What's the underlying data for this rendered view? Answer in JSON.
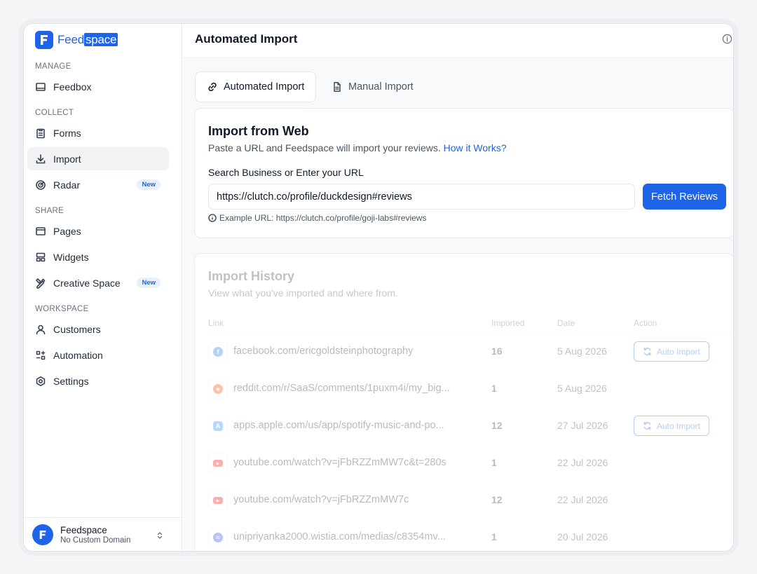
{
  "brand": {
    "name_a": "Feed",
    "name_b": "space",
    "color": "#1d64e8"
  },
  "sidebar": {
    "sections": [
      {
        "label": "MANAGE",
        "items": [
          {
            "label": "Feedbox",
            "icon": "inbox-icon"
          }
        ]
      },
      {
        "label": "COLLECT",
        "items": [
          {
            "label": "Forms",
            "icon": "clipboard-icon"
          },
          {
            "label": "Import",
            "icon": "download-icon"
          },
          {
            "label": "Radar",
            "icon": "radar-icon",
            "badge": "New"
          }
        ]
      },
      {
        "label": "SHARE",
        "items": [
          {
            "label": "Pages",
            "icon": "browser-icon"
          },
          {
            "label": "Widgets",
            "icon": "widget-icon"
          },
          {
            "label": "Creative Space",
            "icon": "pencil-ruler-icon",
            "badge": "New"
          }
        ]
      },
      {
        "label": "WORKSPACE",
        "items": [
          {
            "label": "Customers",
            "icon": "user-icon"
          },
          {
            "label": "Automation",
            "icon": "automation-icon"
          },
          {
            "label": "Settings",
            "icon": "settings-icon"
          }
        ]
      }
    ],
    "active": "Import",
    "account": {
      "name": "Feedspace",
      "subtitle": "No Custom Domain"
    }
  },
  "header": {
    "title": "Automated Import"
  },
  "tabs": [
    {
      "label": "Automated Import",
      "icon": "link-icon",
      "active": true
    },
    {
      "label": "Manual Import",
      "icon": "document-icon",
      "active": false
    }
  ],
  "import_web": {
    "title": "Import from Web",
    "subtitle": "Paste a URL and Feedspace will import your reviews.",
    "help_link": "How it Works?",
    "field_label": "Search Business or Enter your URL",
    "url_value": "https://clutch.co/profile/duckdesign#reviews",
    "fetch_label": "Fetch Reviews",
    "example": "Example URL: https://clutch.co/profile/goji-labs#reviews"
  },
  "history": {
    "title": "Import History",
    "subtitle": "View what you've imported and where from.",
    "columns": [
      "Link",
      "Imported",
      "Date",
      "Action"
    ],
    "rows": [
      {
        "source": "facebook",
        "link": "facebook.com/ericgoldsteinphotography",
        "imported": "16",
        "date": "5 Aug 2026",
        "action": "Auto Import"
      },
      {
        "source": "reddit",
        "link": "reddit.com/r/SaaS/comments/1puxm4i/my_big...",
        "imported": "1",
        "date": "5 Aug 2026",
        "action": ""
      },
      {
        "source": "app-store",
        "link": "apps.apple.com/us/app/spotify-music-and-po...",
        "imported": "12",
        "date": "27 Jul 2026",
        "action": "Auto Import"
      },
      {
        "source": "youtube",
        "link": "youtube.com/watch?v=jFbRZZmMW7c&t=280s",
        "imported": "1",
        "date": "22 Jul 2026",
        "action": ""
      },
      {
        "source": "youtube",
        "link": "youtube.com/watch?v=jFbRZZmMW7c",
        "imported": "12",
        "date": "22 Jul 2026",
        "action": ""
      },
      {
        "source": "wistia",
        "link": "unipriyanka2000.wistia.com/medias/c8354mv...",
        "imported": "1",
        "date": "20 Jul 2026",
        "action": ""
      }
    ]
  }
}
